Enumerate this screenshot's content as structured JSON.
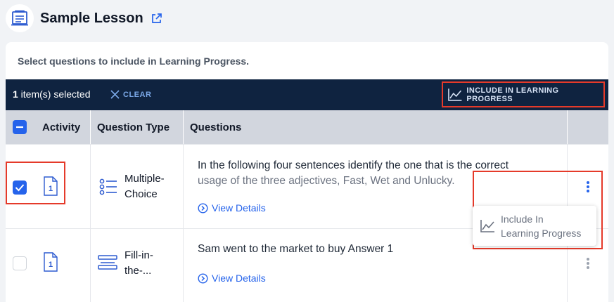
{
  "header": {
    "title": "Sample Lesson",
    "icons": [
      "lesson-icon",
      "external-link-icon"
    ]
  },
  "instructions": "Select questions to include in Learning Progress.",
  "selection_bar": {
    "count": "1",
    "count_suffix": " item(s) selected",
    "clear_label": "CLEAR",
    "include_label": "INCLUDE IN LEARNING PROGRESS"
  },
  "table": {
    "columns": [
      "Activity",
      "Question Type",
      "Questions"
    ],
    "rows": [
      {
        "checked": true,
        "activity_number": "1",
        "type_line1": "Multiple-",
        "type_line2": "Choice",
        "question_line1": "In the following four sentences identify the one that is the correct",
        "question_line2": "usage of the three adjectives, Fast, Wet and Unlucky.",
        "view_details": "View Details"
      },
      {
        "checked": false,
        "activity_number": "1",
        "type_line1": "Fill-in-",
        "type_line2": "the-...",
        "question_line1": "Sam went to the market to buy Answer 1",
        "view_details": "View Details"
      }
    ]
  },
  "row_menu": {
    "item_line1": "Include In",
    "item_line2": "Learning Progress"
  },
  "colors": {
    "accent": "#2563eb",
    "bar": "#0f2340",
    "highlight": "#e53a2a",
    "header_bg": "#d2d6de"
  }
}
